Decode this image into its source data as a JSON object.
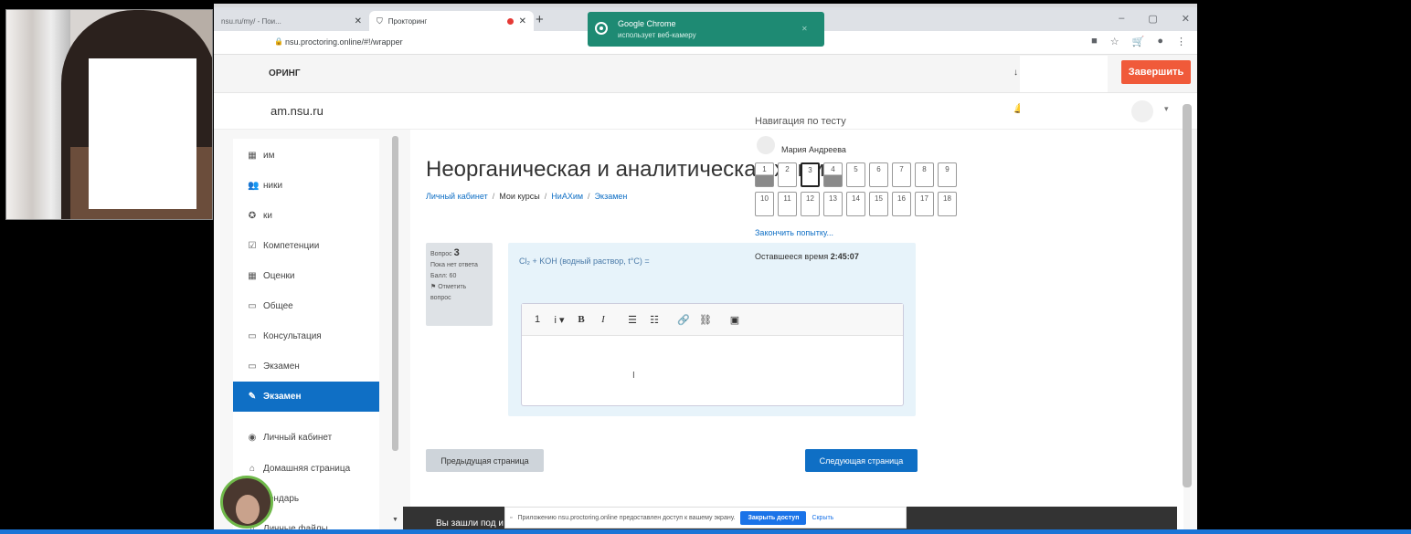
{
  "browser": {
    "tabs": [
      {
        "label": "nsu.ru/my/ - Пои...",
        "active": false
      },
      {
        "label": "Прокторинг",
        "active": true
      }
    ],
    "new_tab_glyph": "+",
    "window_controls": [
      "–",
      "▢",
      "✕"
    ],
    "url": "nsu.proctoring.online/#!/wrapper"
  },
  "toast": {
    "title": "Google Chrome",
    "subtitle": "использует веб-камеру",
    "close": "✕"
  },
  "proctoring": {
    "title": "ОРИНГ",
    "finish_label": "Завершить",
    "finish_color": "#f05a3a"
  },
  "moodle": {
    "site_name": "am.nsu.ru"
  },
  "sidebar": {
    "items": [
      {
        "label": "им",
        "icon": "grid-icon"
      },
      {
        "label": "ники",
        "icon": "users-icon"
      },
      {
        "label": "ки",
        "icon": "badge-icon"
      },
      {
        "label": "Компетенции",
        "icon": "checkbox-icon"
      },
      {
        "label": "Оценки",
        "icon": "table-icon"
      },
      {
        "label": "Общее",
        "icon": "folder-icon"
      },
      {
        "label": "Консультация",
        "icon": "folder-icon"
      },
      {
        "label": "Экзамен",
        "icon": "folder-icon"
      },
      {
        "label": "Экзамен",
        "icon": "quiz-icon",
        "active": true
      },
      {
        "label": "Личный кабинет",
        "icon": "dashboard-icon"
      },
      {
        "label": "Домашняя страница",
        "icon": "home-icon"
      },
      {
        "label": "лендарь",
        "icon": "calendar-icon"
      },
      {
        "label": "Личные файлы",
        "icon": "file-icon"
      }
    ],
    "active_color": "#0f6fc5"
  },
  "main": {
    "title": "Неорганическая и аналитическая химия",
    "breadcrumb": [
      "Личный кабинет",
      "Мои курсы",
      "НиАХим",
      "Экзамен"
    ],
    "question": {
      "label": "Вопрос",
      "number": "3",
      "status": "Пока нет ответа",
      "points": "Балл: 60",
      "flag": "Отметить вопрос",
      "text": "Cl₂ + KOH (водный раствор, t°C) ="
    },
    "editor_toolbar": [
      "1",
      "i ▾",
      "B",
      "I",
      "☰",
      "☷",
      "🔗",
      "⛓",
      "▣"
    ],
    "prev_label": "Предыдущая страница",
    "next_label": "Следующая страница"
  },
  "quiz_nav": {
    "title": "Навигация по тесту",
    "user": "Мария Андреева",
    "questions": [
      {
        "n": "1",
        "state": "answered"
      },
      {
        "n": "2",
        "state": "empty"
      },
      {
        "n": "3",
        "state": "current"
      },
      {
        "n": "4",
        "state": "answered"
      },
      {
        "n": "5",
        "state": "empty"
      },
      {
        "n": "6",
        "state": "empty"
      },
      {
        "n": "7",
        "state": "empty"
      },
      {
        "n": "8",
        "state": "empty"
      },
      {
        "n": "9",
        "state": "empty"
      },
      {
        "n": "10",
        "state": "empty"
      },
      {
        "n": "11",
        "state": "empty"
      },
      {
        "n": "12",
        "state": "empty"
      },
      {
        "n": "13",
        "state": "empty"
      },
      {
        "n": "14",
        "state": "empty"
      },
      {
        "n": "15",
        "state": "empty"
      },
      {
        "n": "16",
        "state": "empty"
      },
      {
        "n": "17",
        "state": "empty"
      },
      {
        "n": "18",
        "state": "empty"
      }
    ],
    "finish_link": "Закончить попытку...",
    "time_label": "Оставшееся время",
    "time_value": "2:45:07"
  },
  "footer": {
    "text": "Вы зашли под и"
  },
  "share_bar": {
    "message": "Приложению nsu.proctoring.online предоставлен доступ к вашему экрану.",
    "stop_label": "Закрыть доступ",
    "hide_label": "Скрыть"
  }
}
